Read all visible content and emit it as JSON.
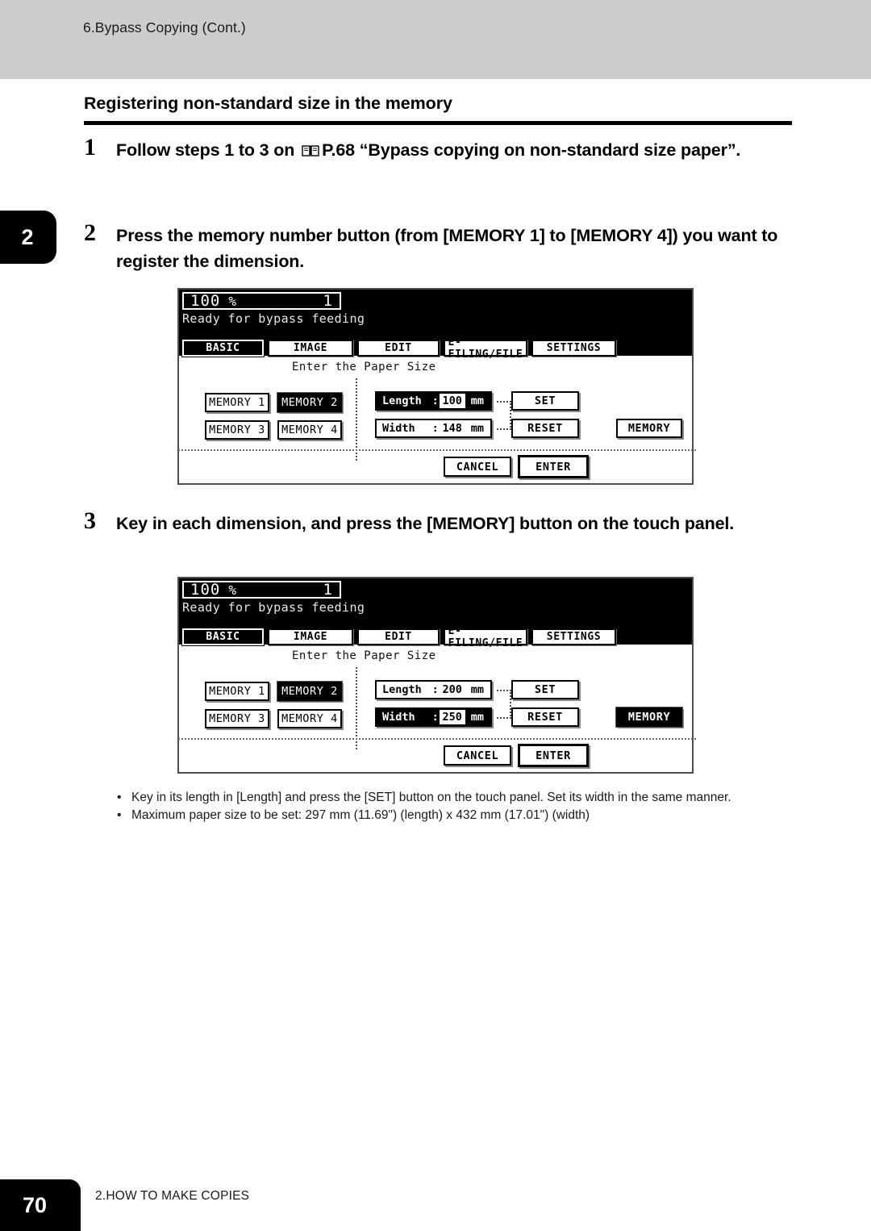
{
  "running_head": "6.Bypass Copying (Cont.)",
  "chapter_tab": "2",
  "section_title": "Registering non-standard size in the memory",
  "steps": [
    {
      "number": "1",
      "text_before_icon": "Follow steps 1 to 3 on ",
      "icon": "book-icon",
      "text_after_icon": "P.68 “Bypass copying on non-standard size paper”."
    },
    {
      "number": "2",
      "text": "Press the memory number button (from [MEMORY 1] to [MEMORY 4]) you want to register the dimension."
    },
    {
      "number": "3",
      "text": "Key in each dimension, and press the [MEMORY] button on the touch panel."
    }
  ],
  "panels": [
    {
      "header": {
        "ratio": "100",
        "percent": "%",
        "copy_count": "1",
        "message": "Ready for bypass feeding"
      },
      "tabs": [
        {
          "label": "BASIC",
          "selected": true
        },
        {
          "label": "IMAGE",
          "selected": false
        },
        {
          "label": "EDIT",
          "selected": false
        },
        {
          "label": "E-FILING/FILE",
          "selected": false
        },
        {
          "label": "SETTINGS",
          "selected": false
        }
      ],
      "prompt": "Enter the Paper Size",
      "memory_buttons": [
        {
          "label": "MEMORY 1",
          "selected": false
        },
        {
          "label": "MEMORY 2",
          "selected": true
        },
        {
          "label": "MEMORY 3",
          "selected": false
        },
        {
          "label": "MEMORY 4",
          "selected": false
        }
      ],
      "fields": {
        "length": {
          "label": "Length",
          "colon": ":",
          "value": "100",
          "unit": "mm",
          "active": true
        },
        "width": {
          "label": "Width",
          "colon": ":",
          "value": "148",
          "unit": "mm",
          "active": false
        }
      },
      "set_label": "SET",
      "reset_label": "RESET",
      "memory_label": "MEMORY",
      "memory_pressed": false,
      "cancel_label": "CANCEL",
      "enter_label": "ENTER"
    },
    {
      "header": {
        "ratio": "100",
        "percent": "%",
        "copy_count": "1",
        "message": "Ready for bypass feeding"
      },
      "tabs": [
        {
          "label": "BASIC",
          "selected": true
        },
        {
          "label": "IMAGE",
          "selected": false
        },
        {
          "label": "EDIT",
          "selected": false
        },
        {
          "label": "E-FILING/FILE",
          "selected": false
        },
        {
          "label": "SETTINGS",
          "selected": false
        }
      ],
      "prompt": "Enter the Paper Size",
      "memory_buttons": [
        {
          "label": "MEMORY 1",
          "selected": false
        },
        {
          "label": "MEMORY 2",
          "selected": true
        },
        {
          "label": "MEMORY 3",
          "selected": false
        },
        {
          "label": "MEMORY 4",
          "selected": false
        }
      ],
      "fields": {
        "length": {
          "label": "Length",
          "colon": ":",
          "value": "200",
          "unit": "mm",
          "active": false
        },
        "width": {
          "label": "Width",
          "colon": ":",
          "value": "250",
          "unit": "mm",
          "active": true
        }
      },
      "set_label": "SET",
      "reset_label": "RESET",
      "memory_label": "MEMORY",
      "memory_pressed": true,
      "cancel_label": "CANCEL",
      "enter_label": "ENTER"
    }
  ],
  "notes": [
    "Key in its length in [Length] and press the [SET] button on the touch panel. Set its width in the same manner.",
    "Maximum paper size to be set: 297 mm (11.69\") (length) x 432 mm (17.01\") (width)"
  ],
  "bullet_glyph": "•",
  "footer": {
    "page_number": "70",
    "chapter": "2.HOW TO MAKE COPIES"
  },
  "colors": {
    "running_head_band": "#cdcdcd",
    "ink": "#000000",
    "panel_border": "#4d4d4d",
    "bevel_shadow": "#8a8a8a"
  }
}
